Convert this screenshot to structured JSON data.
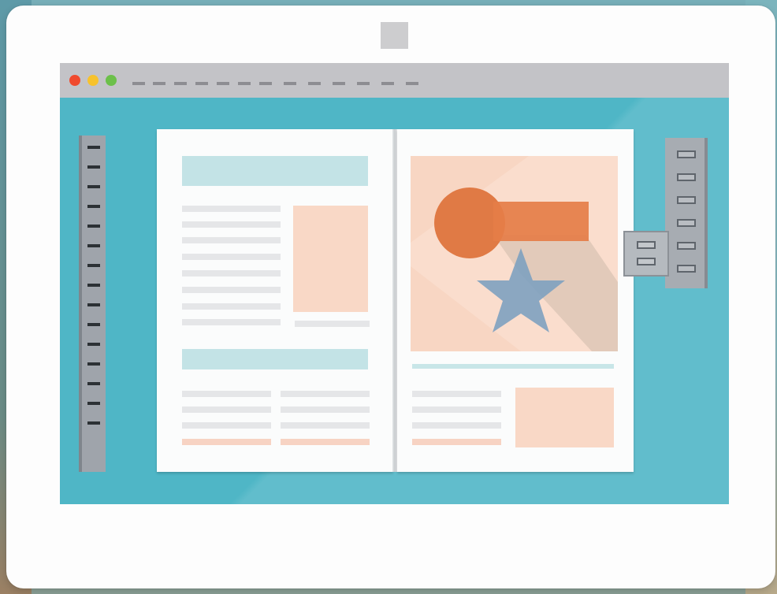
{
  "illustration": {
    "subject": "tablet-showing-page-layout-editor",
    "icons": {
      "camera": "camera-icon",
      "close": "close-dot-icon",
      "minimize": "minimize-dot-icon",
      "maximize": "maximize-dot-icon",
      "circle": "circle-shape-icon",
      "rectangle": "rectangle-shape-icon",
      "star": "star-shape-icon"
    },
    "colors": {
      "screen": "#4fb6c6",
      "titlebar": "#c3c3c7",
      "page": "#fbfcfc",
      "teal_accent": "#c3e3e6",
      "peach_accent": "#f9d8c6",
      "orange_shape": "#e07a45",
      "blue_star": "#7ea1c0",
      "close": "#f04a2e",
      "minimize": "#f7c22c",
      "maximize": "#6cc04a"
    },
    "left_ruler_tick_count": 15,
    "right_palette_button_count": 6,
    "flyout_button_count": 2
  }
}
